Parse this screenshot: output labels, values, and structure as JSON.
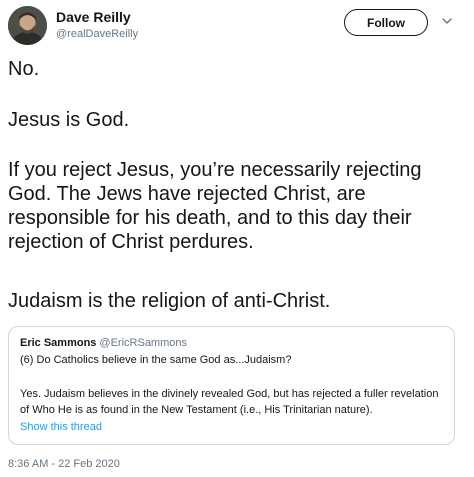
{
  "author": {
    "display_name": "Dave Reilly",
    "handle": "@realDaveReilly",
    "avatar_icon": "profile-photo"
  },
  "follow_label": "Follow",
  "chevron_icon": "chevron-down-icon",
  "tweet": {
    "paragraphs": [
      "No.",
      "Jesus is God.",
      "If you reject Jesus, you’re necessarily rejecting God. The Jews have rejected Christ, are responsible for his death, and to this day their rejection of Christ perdures.",
      "Judaism is the religion of anti-Christ."
    ]
  },
  "quoted_tweet": {
    "author_name": "Eric Sammons",
    "author_handle": "@EricRSammons",
    "line1": "(6) Do Catholics believe in the same God as...Judaism?",
    "body": "Yes. Judaism believes in the divinely revealed God, but has rejected a fuller revelation of Who He is as found in the New Testament (i.e., His Trinitarian nature).",
    "show_thread": "Show this thread"
  },
  "timestamp": "8:36 AM - 22 Feb 2020",
  "colors": {
    "text": "#14171a",
    "secondary": "#657786",
    "link": "#1da1f2",
    "border": "#ccd6dd"
  }
}
